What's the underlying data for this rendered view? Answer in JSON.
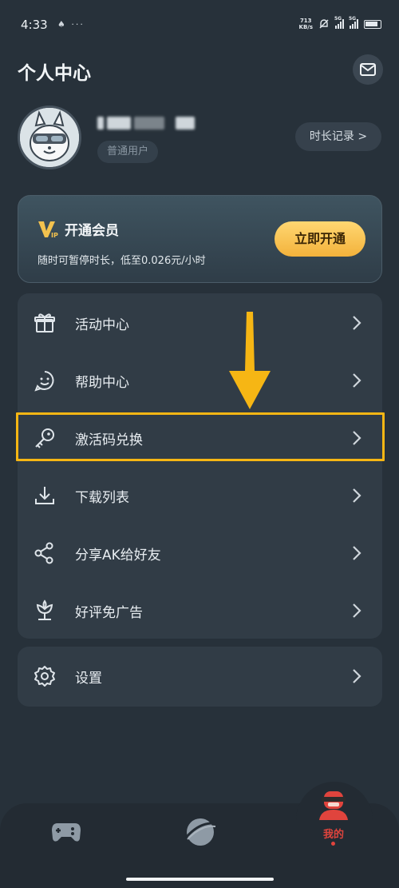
{
  "status_bar": {
    "time": "4:33",
    "left_icons": "♠ ···",
    "speed_top": "713",
    "speed_bottom": "KB/s",
    "sim1": "5G",
    "sim2": "5G"
  },
  "header": {
    "title": "个人中心",
    "message_icon": "mail-icon"
  },
  "profile": {
    "user_badge": "普通用户",
    "record_button": "时长记录 >"
  },
  "vip": {
    "title": "开通会员",
    "subtitle": "随时可暂停时长，低至0.026元/小时",
    "button": "立即开通"
  },
  "menu": {
    "items": [
      {
        "label": "活动中心",
        "icon": "gift-icon"
      },
      {
        "label": "帮助中心",
        "icon": "chat-smile-icon"
      },
      {
        "label": "激活码兑换",
        "icon": "key-icon"
      },
      {
        "label": "下载列表",
        "icon": "download-icon"
      },
      {
        "label": "分享AK给好友",
        "icon": "share-icon"
      },
      {
        "label": "好评免广告",
        "icon": "flower-icon"
      }
    ]
  },
  "settings": {
    "label": "设置",
    "icon": "gear-icon"
  },
  "bottom_nav": {
    "items": [
      {
        "label": "",
        "icon": "gamepad-icon"
      },
      {
        "label": "",
        "icon": "planet-icon"
      },
      {
        "label": "我的",
        "icon": "user-cap-icon",
        "active": true
      }
    ]
  },
  "colors": {
    "background": "#27313a",
    "card": "#313c46",
    "accent_gold": "#f6b614",
    "active_red": "#e0443d"
  }
}
